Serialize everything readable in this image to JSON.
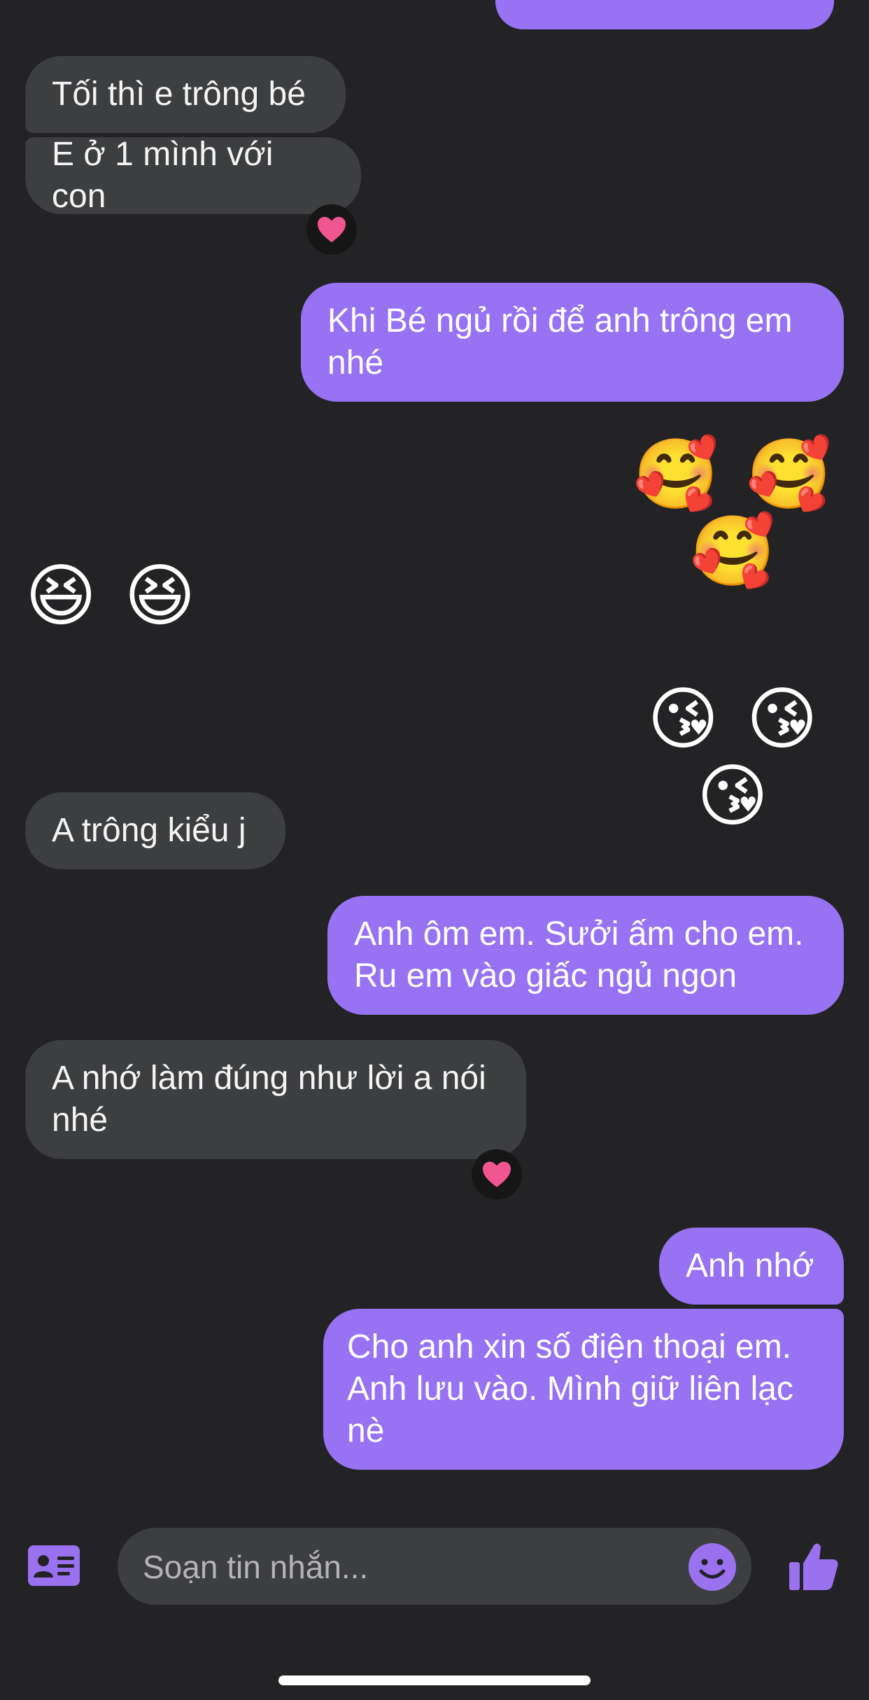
{
  "colors": {
    "background": "#232325",
    "received_bubble": "#3d3e40",
    "sent_bubble": "#9772f2",
    "accent": "#9a72f0"
  },
  "messages": [
    {
      "side": "received",
      "text": "Tối thì e trông bé"
    },
    {
      "side": "received",
      "text": "E ở 1 mình với con",
      "reaction": "heart"
    },
    {
      "side": "sent",
      "text": "Khi Bé ngủ rồi để anh trông em nhé"
    },
    {
      "side": "sent",
      "emoji": "🥰 🥰 🥰"
    },
    {
      "side": "received",
      "emoji": "😆 😆"
    },
    {
      "side": "sent",
      "emoji": "😘 😘 😘"
    },
    {
      "side": "received",
      "text": "A trông kiểu j"
    },
    {
      "side": "sent",
      "text": "Anh ôm em. Sưởi ấm cho em. Ru em vào giấc ngủ ngon"
    },
    {
      "side": "received",
      "text": "A nhớ làm đúng như lời a nói nhé",
      "reaction": "heart"
    },
    {
      "side": "sent",
      "text": "Anh nhớ"
    },
    {
      "side": "sent",
      "text": "Cho anh xin số điện thoại em. Anh lưu vào. Mình giữ liên lạc nè"
    }
  ],
  "composer": {
    "placeholder": "Soạn tin nhắn...",
    "left_icon": "contact-card-icon",
    "emoji_icon": "smiley-icon",
    "send_icon": "thumbs-up-icon"
  }
}
